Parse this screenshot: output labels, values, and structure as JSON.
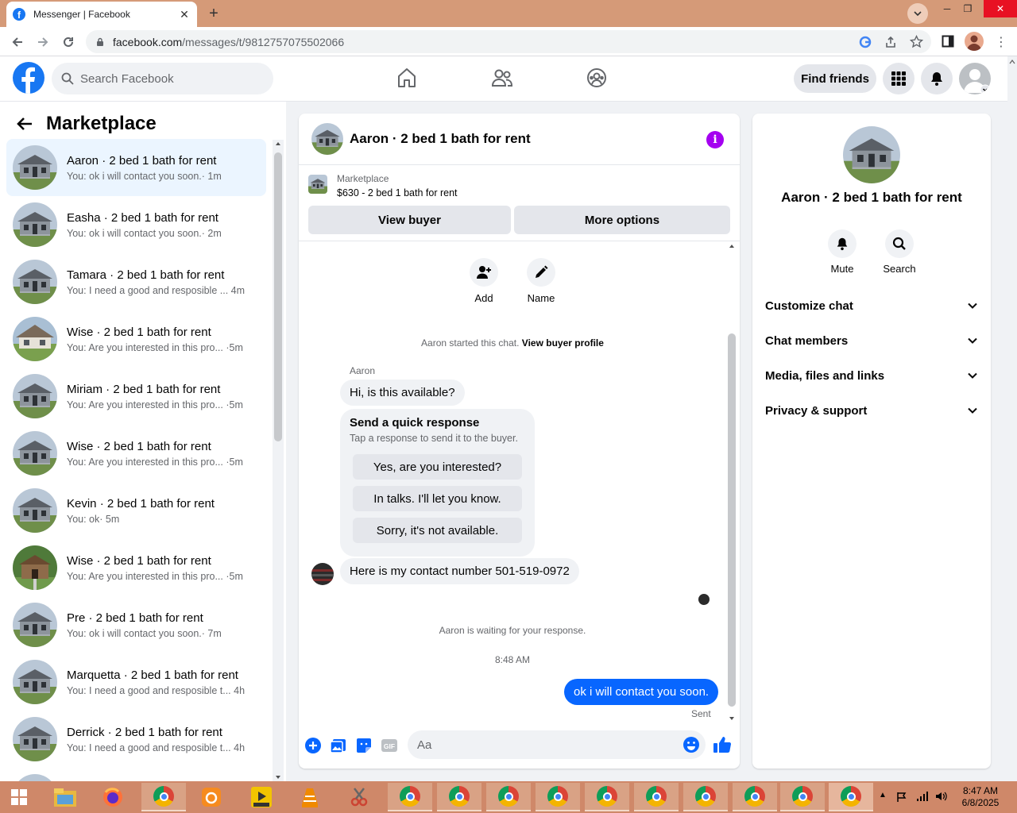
{
  "browser": {
    "tab_title": "Messenger | Facebook",
    "url_host": "facebook.com",
    "url_path": "/messages/t/9812757075502066"
  },
  "fb": {
    "search_placeholder": "Search Facebook",
    "find_friends": "Find friends"
  },
  "sidebar": {
    "title": "Marketplace",
    "conversations": [
      {
        "name": "Aaron · 2 bed 1 bath for rent",
        "preview": "You: ok i will contact you soon.",
        "time": "· 1m"
      },
      {
        "name": "Easha · 2 bed 1 bath for rent",
        "preview": "You: ok i will contact you soon.",
        "time": "· 2m"
      },
      {
        "name": "Tamara · 2 bed 1 bath for rent",
        "preview": "You: I need a good and resposible ...",
        "time": "4m"
      },
      {
        "name": "Wise · 2 bed 1 bath for rent",
        "preview": "You: Are you interested in this pro...",
        "time": "·5m"
      },
      {
        "name": "Miriam · 2 bed 1 bath for rent",
        "preview": "You: Are you interested in this pro...",
        "time": "·5m"
      },
      {
        "name": "Wise · 2 bed 1 bath for rent",
        "preview": "You: Are you interested in this pro...",
        "time": "·5m"
      },
      {
        "name": "Kevin · 2 bed 1 bath for rent",
        "preview": "You: ok",
        "time": "· 5m"
      },
      {
        "name": "Wise · 2 bed 1 bath for rent",
        "preview": "You: Are you interested in this pro...",
        "time": "·5m"
      },
      {
        "name": "Pre · 2 bed 1 bath for rent",
        "preview": "You: ok i will contact you soon.",
        "time": "· 7m"
      },
      {
        "name": "Marquetta · 2 bed 1 bath for rent",
        "preview": "You: I need a good and resposible t...",
        "time": "4h"
      },
      {
        "name": "Derrick · 2 bed 1 bath for rent",
        "preview": "You: I need a good and resposible t...",
        "time": "4h"
      }
    ]
  },
  "chat": {
    "title": "Aaron · 2 bed 1 bath for rent",
    "marketplace_label": "Marketplace",
    "listing": "$630 - 2 bed 1 bath for rent",
    "view_buyer": "View buyer",
    "more_options": "More options",
    "add_label": "Add",
    "name_label": "Name",
    "started_text": "Aaron started this chat.",
    "view_buyer_profile": "View buyer profile",
    "sender": "Aaron",
    "msg1": "Hi, is this available?",
    "quick_title": "Send a quick response",
    "quick_sub": "Tap a response to send it to the buyer.",
    "quick_replies": [
      "Yes, are you interested?",
      "In talks. I'll let you know.",
      "Sorry, it's not available."
    ],
    "msg2": "Here is my contact number 501-519-0972",
    "waiting": "Aaron is waiting for your response.",
    "time": "8:48 AM",
    "my_msg": "ok i will contact you soon.",
    "sent": "Sent",
    "composer_placeholder": "Aa"
  },
  "right_panel": {
    "name": "Aaron · 2 bed 1 bath for rent",
    "mute": "Mute",
    "search": "Search",
    "sections": [
      "Customize chat",
      "Chat members",
      "Media, files and links",
      "Privacy & support"
    ]
  },
  "taskbar": {
    "time": "8:47 AM",
    "date": "6/8/2025"
  },
  "colors": {
    "fb_blue": "#1877f2",
    "messenger_blue": "#0866ff",
    "info_purple": "#a400f0",
    "active_row": "#ebf5ff",
    "chrome_frame": "#d59a78",
    "taskbar": "#cf8869"
  }
}
